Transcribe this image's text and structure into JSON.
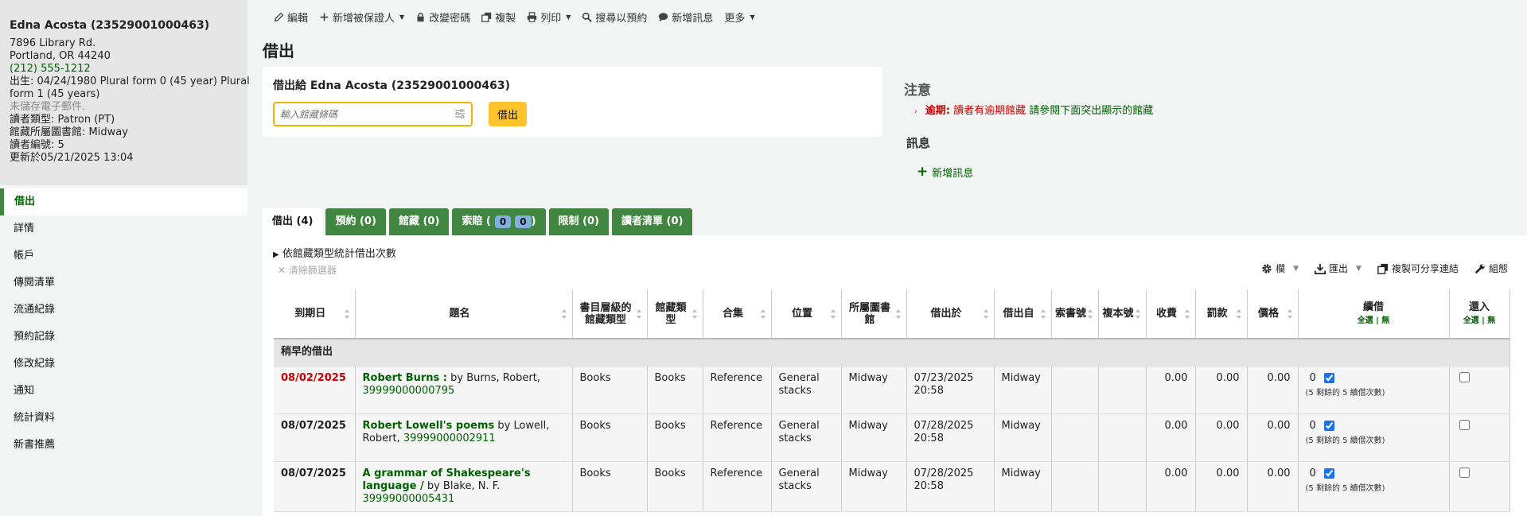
{
  "patron": {
    "name": "Edna Acosta (23529001000463)",
    "address1": "7896 Library Rd.",
    "address2": "Portland, OR 44240",
    "phone": "(212) 555-1212",
    "birth_line1": "出生: 04/24/1980 Plural form 0 (45 year) Plural",
    "birth_line2": "form 1 (45 years)",
    "email": "未儲存電子郵件.",
    "category": "讀者類型: Patron (PT)",
    "library": "館藏所屬圖書館: Midway",
    "number": "讀者編號: 5",
    "updated": "更新於05/21/2025 13:04"
  },
  "nav": [
    "借出",
    "詳情",
    "帳戶",
    "傳閱清單",
    "流通紀錄",
    "預約記錄",
    "修改紀錄",
    "通知",
    "統計資料",
    "新書推薦"
  ],
  "toolbar": {
    "edit": "編輯",
    "add_guarantee": "新增被保證人",
    "change_password": "改變密碼",
    "duplicate": "複製",
    "print": "列印",
    "search_hold": "搜尋以預約",
    "add_message": "新增訊息",
    "more": "更多"
  },
  "page_title": "借出",
  "checkout": {
    "heading": "借出給 Edna Acosta (23529001000463)",
    "placeholder": "輸入館藏條碼",
    "button": "借出"
  },
  "attention": {
    "title": "注意",
    "label": "逾期:",
    "text": "讀者有逾期館藏",
    "link": "請參閱下面突出顯示的館藏"
  },
  "messages": {
    "title": "訊息",
    "add": "新增訊息"
  },
  "tabs": [
    {
      "label": "借出 (4)"
    },
    {
      "label": "預約 (0)"
    },
    {
      "label": "館藏 (0)"
    },
    {
      "label": "索賠 (",
      "b1": "0",
      "b2": "0",
      "tail": ")"
    },
    {
      "label": "限制 (0)"
    },
    {
      "label": "讀者清單 (0)"
    }
  ],
  "panel": {
    "stats_toggle": "依館藏類型統計借出次數",
    "clear_filter": "清除篩選器",
    "tools": {
      "columns": "欄",
      "export": "匯出",
      "copy_link": "複製可分享連結",
      "settings": "組態"
    }
  },
  "table": {
    "headers": [
      "到期日",
      "題名",
      "書目層級的館藏類型",
      "館藏類型",
      "合集",
      "位置",
      "所屬圖書館",
      "借出於",
      "借出自",
      "索書號",
      "複本號",
      "收費",
      "罰款",
      "價格",
      "續借",
      "還入"
    ],
    "renew_sub": "全選 | 無",
    "checkin_sub": "全選 | 無",
    "group_label": "稍早的借出",
    "rows": [
      {
        "due": "08/02/2025",
        "overdue": true,
        "title": "Robert Burns :",
        "author": " by Burns, Robert,",
        "barcode": "39999000000795",
        "biblio_type": "Books",
        "item_type": "Books",
        "collection": "Reference",
        "location": "General stacks",
        "library": "Midway",
        "checked_out_on": "07/23/2025 20:58",
        "from": "Midway",
        "callnum": "",
        "copy": "",
        "charge": "0.00",
        "fine": "0.00",
        "price": "0.00",
        "renewals": "0",
        "renew_info": "(5 剩餘的 5 續借次數)"
      },
      {
        "due": "08/07/2025",
        "overdue": false,
        "title": "Robert Lowell's poems",
        "author": " by Lowell, Robert,",
        "barcode": "39999000002911",
        "biblio_type": "Books",
        "item_type": "Books",
        "collection": "Reference",
        "location": "General stacks",
        "library": "Midway",
        "checked_out_on": "07/28/2025 20:58",
        "from": "Midway",
        "callnum": "",
        "copy": "",
        "charge": "0.00",
        "fine": "0.00",
        "price": "0.00",
        "renewals": "0",
        "renew_info": "(5 剩餘的 5 續借次數)"
      },
      {
        "due": "08/07/2025",
        "overdue": false,
        "title": "A grammar of Shakespeare's language /",
        "author": " by Blake, N. F.",
        "barcode": "39999000005431",
        "biblio_type": "Books",
        "item_type": "Books",
        "collection": "Reference",
        "location": "General stacks",
        "library": "Midway",
        "checked_out_on": "07/28/2025 20:58",
        "from": "Midway",
        "callnum": "",
        "copy": "",
        "charge": "0.00",
        "fine": "0.00",
        "price": "0.00",
        "renewals": "0",
        "renew_info": "(5 剩餘的 5 續借次數)"
      }
    ]
  }
}
